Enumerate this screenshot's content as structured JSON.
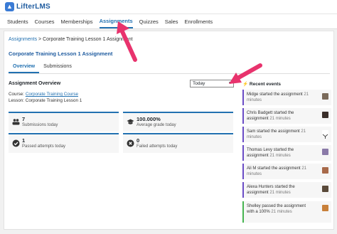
{
  "app": {
    "logo_text": "LifterLMS"
  },
  "nav": {
    "items": [
      {
        "label": "Students"
      },
      {
        "label": "Courses"
      },
      {
        "label": "Memberships"
      },
      {
        "label": "Assignments"
      },
      {
        "label": "Quizzes"
      },
      {
        "label": "Sales"
      },
      {
        "label": "Enrollments"
      }
    ],
    "active": "Assignments"
  },
  "breadcrumb": {
    "root": "Assignments",
    "sep": ">",
    "current": "Corporate Training Lesson 1 Assignment"
  },
  "page": {
    "title": "Corporate Training Lesson 1 Assignment"
  },
  "tabs": [
    {
      "label": "Overview"
    },
    {
      "label": "Submissions"
    }
  ],
  "overview": {
    "title": "Assignment Overview",
    "range_select": "Today",
    "course_label": "Course:",
    "course_link": "Corporate Training Course",
    "lesson_text": "Lesson: Corporate Training Lesson 1"
  },
  "stats": [
    {
      "icon": "users-icon",
      "value": "7",
      "label": "Submissions today"
    },
    {
      "icon": "graduation-cap-icon",
      "value": "100.000%",
      "label": "Average grade today"
    },
    {
      "icon": "check-circle-icon",
      "value": "1",
      "label": "Passed attempts today"
    },
    {
      "icon": "x-circle-icon",
      "value": "0",
      "label": "Failed attempts today"
    }
  ],
  "events": {
    "title": "Recent events",
    "items": [
      {
        "text": "Midge started the assignment",
        "time": "21 minutes"
      },
      {
        "text": "Chris Badgett started the assignment",
        "time": "21 minutes"
      },
      {
        "text": "Sam started the assignment",
        "time": "21 minutes"
      },
      {
        "text": "Thomas Levy started the assignment",
        "time": "21 minutes"
      },
      {
        "text": "Ali M started the assignment",
        "time": "21 minutes"
      },
      {
        "text": "Alexa Hunters started the assignment",
        "time": "21 minutes"
      },
      {
        "text": "Shelley passed the assignment with a 100%",
        "time": "21 minutes"
      }
    ]
  },
  "colors": {
    "accent": "#2271b1",
    "event_purple": "#6a4cc6",
    "event_green": "#46b450",
    "annotation_arrow": "#e8336d"
  }
}
